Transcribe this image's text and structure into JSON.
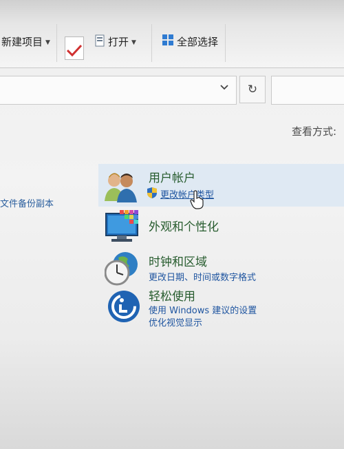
{
  "toolbar": {
    "new_item_label": "新建项目",
    "open_label": "打开",
    "select_all_label": "全部选择"
  },
  "address": {
    "refresh_icon": "↻",
    "dropdown_icon": "⌄"
  },
  "view_by_label": "查看方式:",
  "left_panel": {
    "link_label": "文件备份副本"
  },
  "categories": [
    {
      "title": "用户帐户",
      "icon": "users-icon",
      "links": [
        "更改帐户类型"
      ]
    },
    {
      "title": "外观和个性化",
      "icon": "monitor-personalization-icon",
      "links": []
    },
    {
      "title": "时钟和区域",
      "icon": "clock-globe-icon",
      "links": [
        "更改日期、时间或数字格式"
      ]
    },
    {
      "title": "轻松使用",
      "icon": "ease-of-access-icon",
      "links": [
        "使用 Windows 建议的设置",
        "优化视觉显示"
      ]
    }
  ]
}
